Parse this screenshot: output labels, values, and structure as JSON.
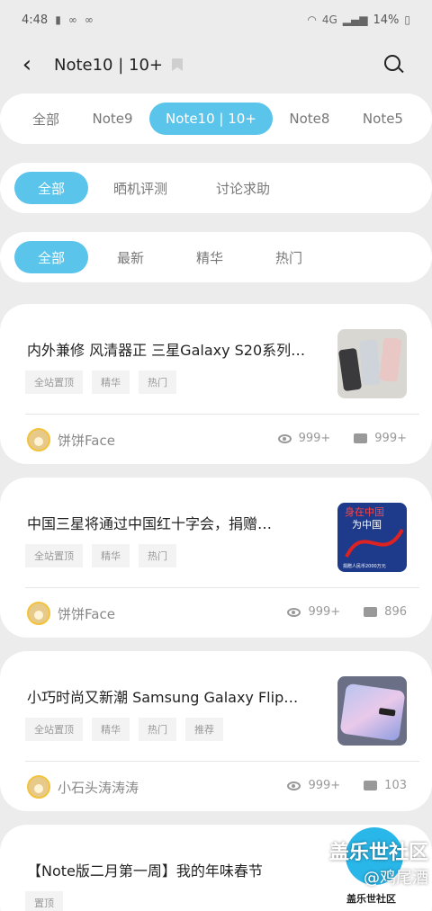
{
  "status": {
    "time": "4:48",
    "battery": "14%",
    "network": "4G"
  },
  "header": {
    "title": "Note10 | 10+"
  },
  "model_tabs": [
    "全部",
    "Note9",
    "Note10 | 10+",
    "Note8",
    "Note5"
  ],
  "category_tabs": [
    "全部",
    "晒机评测",
    "讨论求助"
  ],
  "sort_tabs": [
    "全部",
    "最新",
    "精华",
    "热门"
  ],
  "posts": [
    {
      "title": "内外兼修 风清器正 三星Galaxy S20系列…",
      "tags": [
        "全站置顶",
        "精华",
        "热门"
      ],
      "author": "饼饼Face",
      "views": "999+",
      "comments": "999+"
    },
    {
      "title": "中国三星将通过中国红十字会，捐赠…",
      "tags": [
        "全站置顶",
        "精华",
        "热门"
      ],
      "author": "饼饼Face",
      "views": "999+",
      "comments": "896"
    },
    {
      "title": "小巧时尚又新潮 Samsung Galaxy Flip…",
      "tags": [
        "全站置顶",
        "精华",
        "热门",
        "推荐"
      ],
      "author": "小石头涛涛涛",
      "views": "999+",
      "comments": "103"
    },
    {
      "title": "【Note版二月第一周】我的年味春节",
      "tags": [
        "置顶"
      ]
    }
  ],
  "thumb2": {
    "line1": "身在中国",
    "line2": "为中国",
    "caption": "捐赠人民币2000万元"
  },
  "watermark": {
    "line1": "盖乐世社区",
    "line2": "@鸡尾酒"
  },
  "fab_label": "盖乐世社区",
  "colors": {
    "accent": "#5bc4ea",
    "background": "#ececec",
    "card": "#ffffff"
  }
}
